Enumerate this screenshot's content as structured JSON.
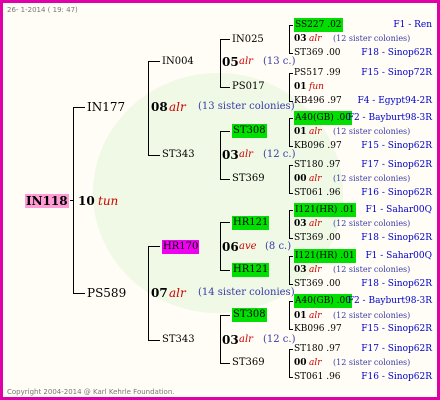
{
  "title": "26- 1-2014 ( 19: 47)",
  "copyright": "Copyright 2004-2014 @ Karl Kehrle Foundation.",
  "root": {
    "name": "IN118",
    "year": "10",
    "trait": "tun"
  },
  "gen1": [
    {
      "name": "IN177",
      "year": "08",
      "trait": "alr",
      "note": "(13 sister colonies)"
    },
    {
      "name": "PS589",
      "year": "07",
      "trait": "alr",
      "note": "(14 sister colonies)"
    }
  ],
  "gen2": [
    {
      "name": "IN004",
      "year": "05",
      "trait": "alr",
      "note": "(13 c.)"
    },
    {
      "name": "ST343",
      "year": "03",
      "trait": "alr",
      "note": "(12 c.)"
    },
    {
      "name": "HR170",
      "year": "06",
      "trait": "ave",
      "note": "(8 c.)"
    },
    {
      "name": "ST343",
      "year": "03",
      "trait": "alr",
      "note": "(12 c.)"
    }
  ],
  "gen3": [
    {
      "name": "IN025",
      "year": "03",
      "trait": "alr",
      "note": "(12 sister colonies)"
    },
    {
      "name": "PS017",
      "year": "01",
      "trait": "fun",
      "note": ""
    },
    {
      "name": "ST308",
      "year": "01",
      "trait": "alr",
      "note": "(12 sister colonies)"
    },
    {
      "name": "ST369",
      "year": "00",
      "trait": "alr",
      "note": "(12 sister colonies)"
    },
    {
      "name": "HR121",
      "year": "03",
      "trait": "alr",
      "note": "(12 sister colonies)"
    },
    {
      "name": "HR121",
      "year": "03",
      "trait": "alr",
      "note": "(12 sister colonies)"
    },
    {
      "name": "ST308",
      "year": "01",
      "trait": "alr",
      "note": "(12 sister colonies)"
    },
    {
      "name": "ST369",
      "year": "00",
      "trait": "alr",
      "note": "(12 sister colonies)"
    }
  ],
  "gen4": [
    {
      "name": "SS227 .02",
      "origin": "F1 - Ren"
    },
    {
      "name": "ST369 .00",
      "origin": "F18 - Sinop62R"
    },
    {
      "name": "PS517 .99",
      "origin": "F15 - Sinop72R"
    },
    {
      "name": "KB496 .97",
      "origin": "F4 - Egypt94-2R"
    },
    {
      "name": "A40(GB) .00",
      "origin": "F2 - Bayburt98-3R"
    },
    {
      "name": "KB096 .97",
      "origin": "F15 - Sinop62R"
    },
    {
      "name": "ST180 .97",
      "origin": "F17 - Sinop62R"
    },
    {
      "name": "ST061 .96",
      "origin": "F16 - Sinop62R"
    },
    {
      "name": "I121(HR) .01",
      "origin": "F1 - Sahar00Q"
    },
    {
      "name": "ST369 .00",
      "origin": "F18 - Sinop62R"
    },
    {
      "name": "I121(HR) .01",
      "origin": "F1 - Sahar00Q"
    },
    {
      "name": "ST369 .00",
      "origin": "F18 - Sinop62R"
    },
    {
      "name": "A40(GB) .00",
      "origin": "F2 - Bayburt98-3R"
    },
    {
      "name": "KB096 .97",
      "origin": "F15 - Sinop62R"
    },
    {
      "name": "ST180 .97",
      "origin": "F17 - Sinop62R"
    },
    {
      "name": "ST061 .96",
      "origin": "F16 - Sinop62R"
    }
  ],
  "colors": {
    "border": "#e000a8",
    "highlight_green": "#00e000",
    "highlight_magenta": "#f000f0",
    "highlight_pink": "#ff9bd5"
  }
}
